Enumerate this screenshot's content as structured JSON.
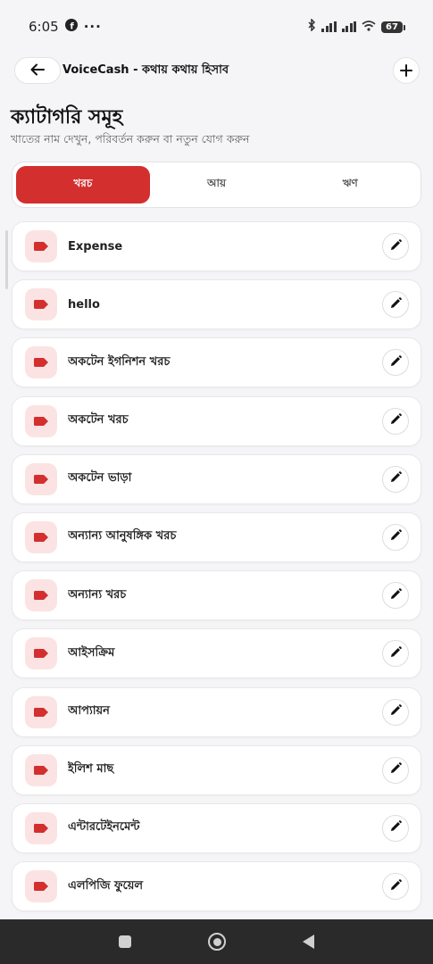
{
  "status_bar": {
    "time": "6:05",
    "battery": "67"
  },
  "app_bar": {
    "title": "VoiceCash - কথায় কথায় হিসাব"
  },
  "page": {
    "title": "ক্যাটাগরি সমূহ",
    "subtitle": "খাতের নাম দেখুন, পরিবর্তন করুন বা নতুন যোগ করুন"
  },
  "tabs": [
    {
      "label": "খরচ",
      "active": true
    },
    {
      "label": "আয়",
      "active": false
    },
    {
      "label": "ঋণ",
      "active": false
    }
  ],
  "categories": [
    {
      "name": "Expense"
    },
    {
      "name": "hello"
    },
    {
      "name": "অকটেন ইগনিশন খরচ"
    },
    {
      "name": "অকটেন খরচ"
    },
    {
      "name": "অকটেন ভাড়া"
    },
    {
      "name": "অন্যান্য আনুষঙ্গিক খরচ"
    },
    {
      "name": "অন্যান্য খরচ"
    },
    {
      "name": "আইসক্রিম"
    },
    {
      "name": "আপ্যায়ন"
    },
    {
      "name": "ইলিশ মাছ"
    },
    {
      "name": "এন্টারটেইনমেন্ট"
    },
    {
      "name": "এলপিজি ফুয়েল"
    }
  ],
  "icons": {
    "back": "arrow-left-icon",
    "add": "plus-icon",
    "category": "tag-icon",
    "edit": "pencil-icon"
  },
  "colors": {
    "accent": "#d32f2f",
    "tag_bg": "#fbe3e3"
  }
}
